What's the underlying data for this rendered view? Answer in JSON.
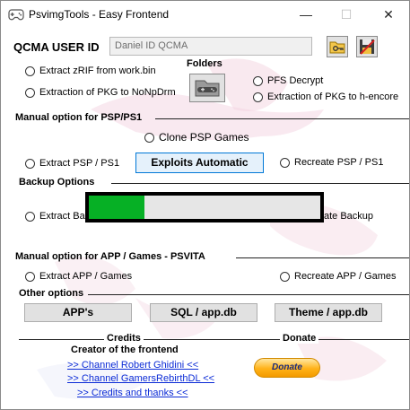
{
  "window": {
    "title": "PsvimgTools - Easy Frontend",
    "minimize": "—",
    "maximize": "☐",
    "close": "✕"
  },
  "qcma": {
    "label": "QCMA USER ID",
    "value": "Daniel ID QCMA"
  },
  "folders": {
    "label": "Folders"
  },
  "top_options": {
    "extract_zrif": "Extract zRIF from work.bin",
    "extract_pkg_nonpdrm": "Extraction of PKG to NoNpDrm",
    "pfs_decrypt": "PFS Decrypt",
    "extract_pkg_hencore": "Extraction of PKG to h-encore"
  },
  "psp": {
    "section_label": "Manual option for PSP/PS1",
    "clone": "Clone PSP Games",
    "extract": "Extract PSP / PS1",
    "exploits_button": "Exploits Automatic",
    "recreate": "Recreate PSP / PS1"
  },
  "backup": {
    "section_label": "Backup Options",
    "extract": "Extract Ba",
    "recreate": "ate Backup",
    "progress": 0.24
  },
  "app": {
    "section_label": "Manual option for APP / Games - PSVITA",
    "extract": "Extract APP / Games",
    "recreate": "Recreate APP / Games"
  },
  "other": {
    "section_label": "Other options",
    "apps_button": "APP's",
    "sql_button": "SQL / app.db",
    "theme_button": "Theme / app.db"
  },
  "credits": {
    "label": "Credits",
    "creator": "Creator of the frontend",
    "links": [
      ">> Channel Robert Ghidini <<",
      ">> Channel GamersRebirthDL <<",
      ">> Credits and thanks <<"
    ]
  },
  "donate": {
    "label": "Donate",
    "button": "Donate"
  },
  "colors": {
    "progress": "#06b025",
    "link": "#0b2bd6",
    "donate_bg": "#ffb218"
  }
}
